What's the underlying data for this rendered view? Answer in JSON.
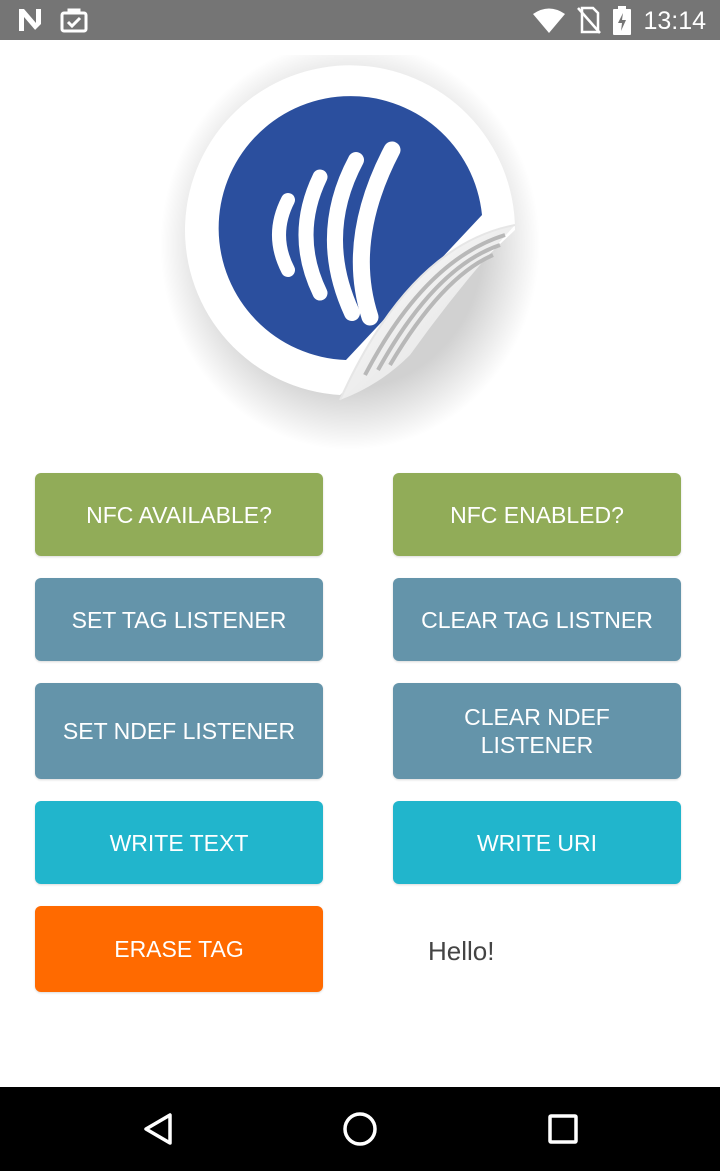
{
  "status_bar": {
    "time": "13:14",
    "icons": [
      "notification-n-icon",
      "briefcase-check-icon",
      "wifi-icon",
      "no-sim-icon",
      "battery-charging-icon"
    ]
  },
  "logo": {
    "name": "nfc-sticker-logo",
    "circle_color": "#2b4f9e"
  },
  "buttons": {
    "nfc_available": "NFC AVAILABLE?",
    "nfc_enabled": "NFC ENABLED?",
    "set_tag_listener": "SET TAG LISTENER",
    "clear_tag_listener": "CLEAR TAG LISTNER",
    "set_ndef_listener": "SET NDEF LISTENER",
    "clear_ndef_listener_line1": "CLEAR NDEF",
    "clear_ndef_listener_line2": "LISTENER",
    "write_text": "WRITE TEXT",
    "write_uri": "WRITE URI",
    "erase_tag": "ERASE TAG"
  },
  "message": "Hello!",
  "colors": {
    "green": "#91ac58",
    "slate": "#6494aa",
    "cyan": "#21b5cc",
    "orange": "#ff6a00"
  },
  "nav_bar": {
    "icons": [
      "back-icon",
      "home-icon",
      "recents-icon"
    ]
  }
}
